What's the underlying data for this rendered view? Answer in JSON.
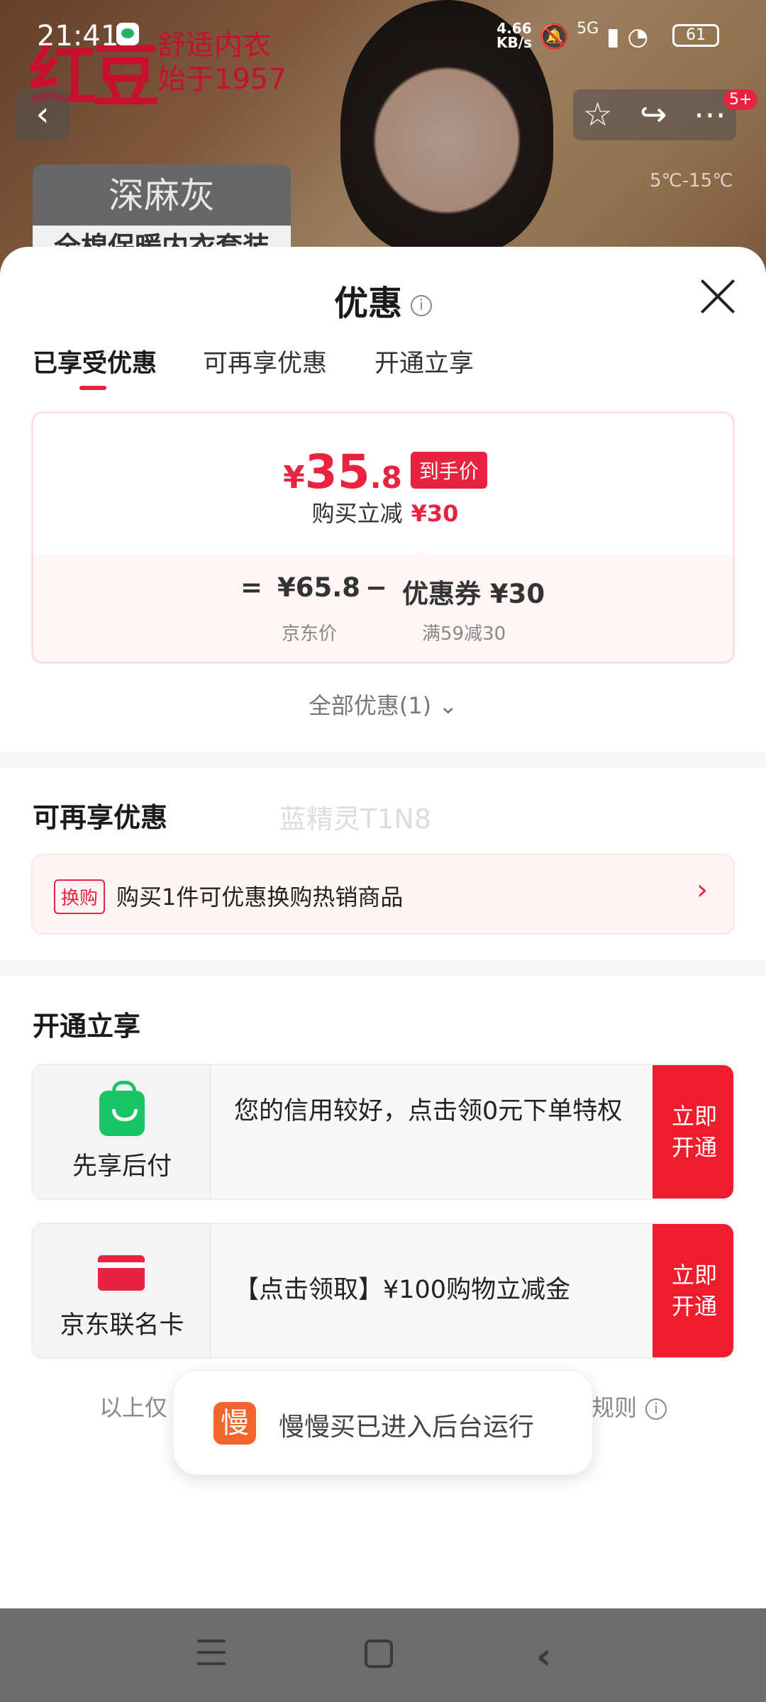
{
  "status_bar": {
    "time": "21:41",
    "net_speed_value": "4.66",
    "net_speed_unit": "KB/s",
    "network": "5G",
    "battery": "61"
  },
  "background": {
    "brand_logo": "红豆",
    "brand_slogan_1": "舒适内衣",
    "brand_slogan_2": "始于1957",
    "color_name": "深麻灰",
    "product_subtitle": "全棉保暖内衣套装",
    "notification_count": "5+",
    "weather_temp": "5℃-15℃"
  },
  "sheet": {
    "title": "优惠",
    "tabs": [
      {
        "label": "已享受优惠",
        "active": true
      },
      {
        "label": "可再享优惠",
        "active": false
      },
      {
        "label": "开通立享",
        "active": false
      }
    ]
  },
  "price_box": {
    "currency": "¥",
    "final_price_int": "35",
    "final_price_dec": ".8",
    "price_tag": "到手价",
    "reduce_label": "购买立减",
    "reduce_amount": "¥30",
    "eq": "=",
    "jd_price": "¥65.8",
    "minus": "−",
    "coupon_label": "优惠券 ¥30",
    "jd_price_label": "京东价",
    "coupon_rule": "满59减30"
  },
  "all_discounts": "全部优惠(1)",
  "more_section": {
    "title": "可再享优惠",
    "watermark": "蓝精灵T1N8",
    "exchange_tag": "换购",
    "exchange_text": "购买1件可优惠换购热销商品"
  },
  "open_section": {
    "title": "开通立享",
    "cards": [
      {
        "label": "先享后付",
        "desc": "您的信用较好，点击领0元下单特权",
        "btn_line1": "立即",
        "btn_line2": "开通"
      },
      {
        "label": "京东联名卡",
        "desc": "【点击领取】¥100购物立减金",
        "btn_line1": "立即",
        "btn_line2": "开通"
      }
    ]
  },
  "disclaimer_left": "以上仅",
  "disclaimer_right": "规则",
  "toast": {
    "logo": "慢",
    "text": "慢慢买已进入后台运行"
  },
  "colors": {
    "accent": "#e8233f",
    "button": "#ee1c2c",
    "green": "#19c464"
  }
}
